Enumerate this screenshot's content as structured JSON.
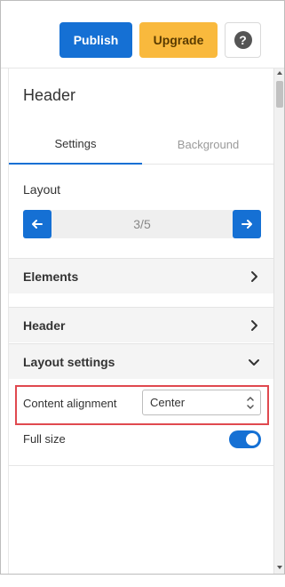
{
  "toolbar": {
    "publish_label": "Publish",
    "upgrade_label": "Upgrade",
    "help_label": "?"
  },
  "panel": {
    "title": "Header",
    "tabs": [
      {
        "label": "Settings",
        "active": true
      },
      {
        "label": "Background",
        "active": false
      }
    ],
    "layout": {
      "label": "Layout",
      "value": "3/5",
      "prev_icon": "arrow-left-icon",
      "next_icon": "arrow-right-icon"
    },
    "sections": [
      {
        "label": "Elements",
        "expanded": false,
        "icon": "chevron-right-icon"
      },
      {
        "label": "Header",
        "expanded": false,
        "icon": "chevron-right-icon"
      },
      {
        "label": "Layout settings",
        "expanded": true,
        "icon": "chevron-down-icon"
      }
    ],
    "layout_settings": {
      "content_alignment_label": "Content alignment",
      "content_alignment_value": "Center",
      "full_size_label": "Full size",
      "full_size_on": true
    }
  },
  "colors": {
    "primary": "#1570d4",
    "upgrade": "#f9b93d",
    "highlight": "#e0494f"
  }
}
